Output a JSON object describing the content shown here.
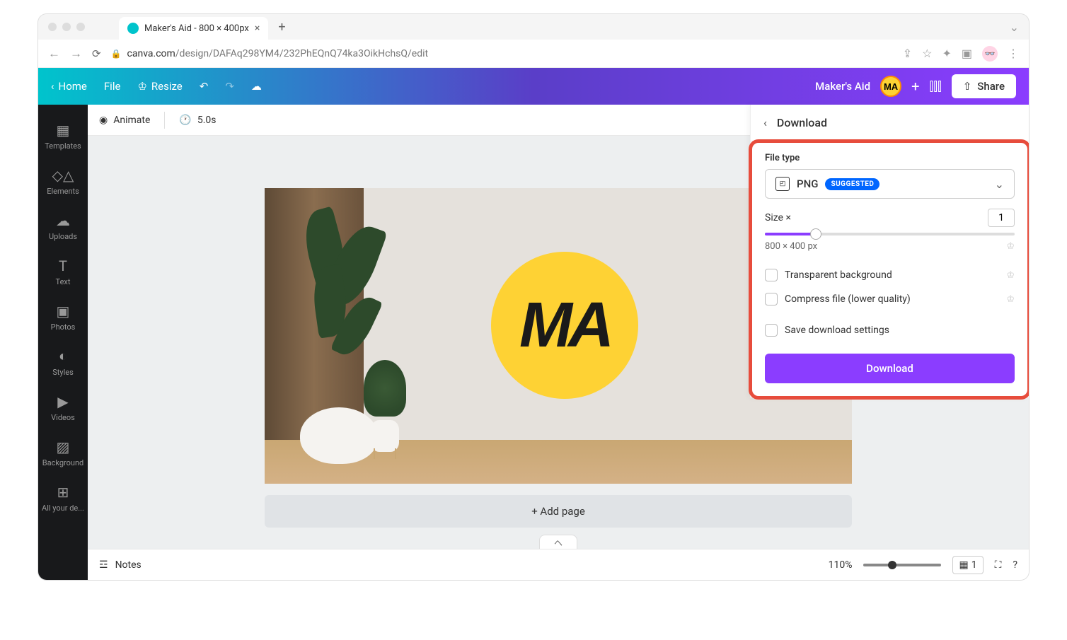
{
  "browser": {
    "tab_title": "Maker's Aid - 800 × 400px",
    "url_host": "canva.com",
    "url_path": "/design/DAFAq298YM4/232PhEQnQ74ka3OikHchsQ/edit"
  },
  "toolbar": {
    "home": "Home",
    "file": "File",
    "resize": "Resize",
    "project_name": "Maker's Aid",
    "user_badge": "MA",
    "share": "Share"
  },
  "sidenav": {
    "templates": "Templates",
    "elements": "Elements",
    "uploads": "Uploads",
    "text": "Text",
    "photos": "Photos",
    "styles": "Styles",
    "videos": "Videos",
    "background": "Background",
    "allyour": "All your de..."
  },
  "editor_toolbar": {
    "animate": "Animate",
    "duration": "5.0s"
  },
  "canvas": {
    "logo_text": "MA",
    "add_page": "+ Add page"
  },
  "footer": {
    "notes": "Notes",
    "zoom": "110%",
    "page_number": "1"
  },
  "download": {
    "title": "Download",
    "file_type_label": "File type",
    "file_type": "PNG",
    "suggested": "SUGGESTED",
    "size_label": "Size ×",
    "size_value": "1",
    "dimensions": "800 × 400 px",
    "transparent_bg": "Transparent background",
    "compress": "Compress file (lower quality)",
    "save_settings": "Save download settings",
    "download_btn": "Download"
  }
}
